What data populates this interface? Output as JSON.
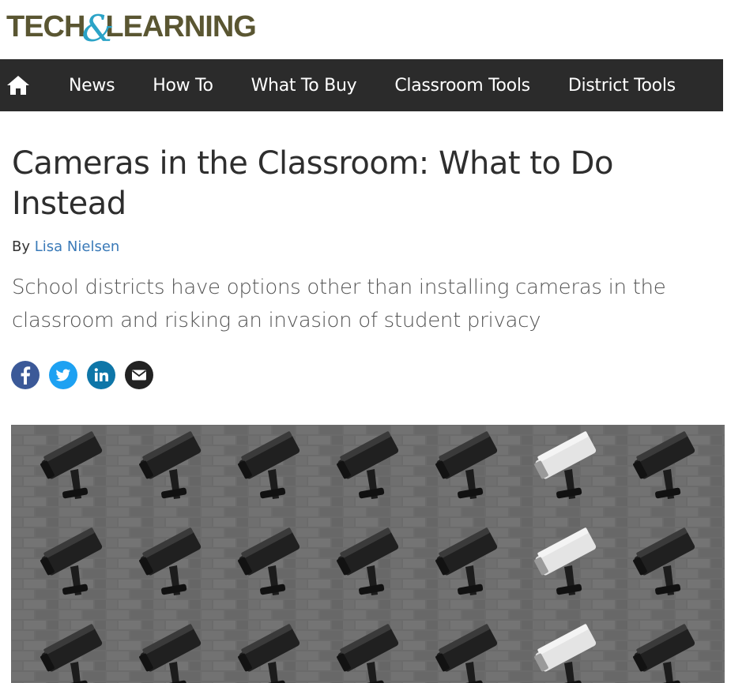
{
  "logo": {
    "part1": "TECH",
    "amp": "&",
    "part2": "LEARNING"
  },
  "nav": {
    "items": [
      {
        "label": "News"
      },
      {
        "label": "How To"
      },
      {
        "label": "What To Buy"
      },
      {
        "label": "Classroom Tools"
      },
      {
        "label": "District Tools"
      }
    ]
  },
  "article": {
    "title": "Cameras in the Classroom: What to Do Instead",
    "by_label": "By",
    "author": "Lisa Nielsen",
    "subtitle": "School districts have options other than installing cameras in the classroom and risking an invasion of student privacy"
  },
  "share": [
    {
      "icon": "facebook-icon",
      "color": "#3b5998"
    },
    {
      "icon": "twitter-icon",
      "color": "#1da1f2"
    },
    {
      "icon": "linkedin-icon",
      "color": "#0e76a8"
    },
    {
      "icon": "email-icon",
      "color": "#222222"
    }
  ],
  "colors": {
    "logo_text": "#5a5632",
    "logo_amp": "#2ba3c7",
    "nav_bg": "#2b2b2b",
    "link": "#3a7ab8"
  }
}
